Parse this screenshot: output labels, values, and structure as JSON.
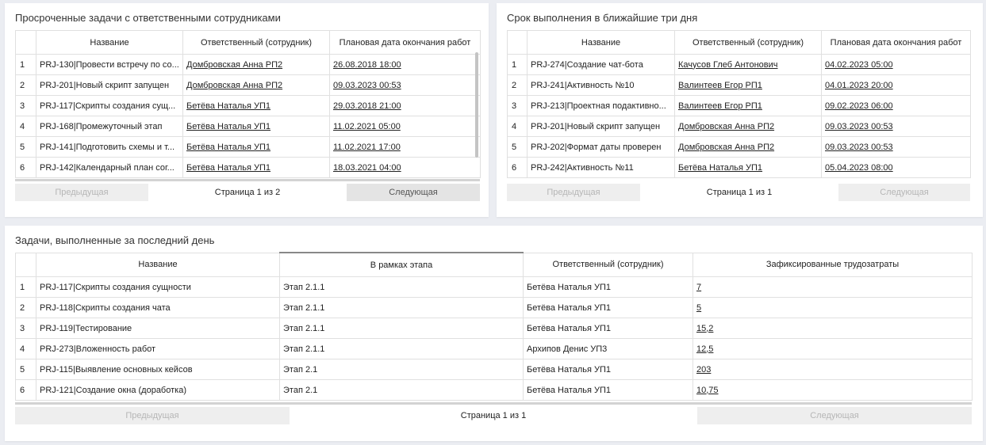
{
  "overdue": {
    "title": "Просроченные задачи с ответственными сотрудниками",
    "columns": [
      "",
      "Название",
      "Ответственный (сотрудник)",
      "Плановая дата окончания работ"
    ],
    "rows": [
      {
        "n": "1",
        "name": "PRJ-130|Провести встречу по со...",
        "person": "Домбровская Анна РП2",
        "date": "26.08.2018 18:00"
      },
      {
        "n": "2",
        "name": "PRJ-201|Новый скрипт запущен",
        "person": "Домбровская Анна РП2",
        "date": "09.03.2023 00:53"
      },
      {
        "n": "3",
        "name": "PRJ-117|Скрипты создания сущ...",
        "person": "Бетёва Наталья УП1",
        "date": "29.03.2018 21:00"
      },
      {
        "n": "4",
        "name": "PRJ-168|Промежуточный этап",
        "person": "Бетёва Наталья УП1",
        "date": "11.02.2021 05:00"
      },
      {
        "n": "5",
        "name": "PRJ-141|Подготовить схемы и т...",
        "person": "Бетёва Наталья УП1",
        "date": "11.02.2021 17:00"
      },
      {
        "n": "6",
        "name": "PRJ-142|Календарный план сог...",
        "person": "Бетёва Наталья УП1",
        "date": "18.03.2021 04:00"
      }
    ],
    "pager": {
      "prev": "Предыдущая",
      "info": "Страница 1 из 2",
      "next": "Следующая"
    }
  },
  "due_soon": {
    "title": "Срок выполнения в ближайшие три дня",
    "columns": [
      "",
      "Название",
      "Ответственный (сотрудник)",
      "Плановая дата окончания работ"
    ],
    "rows": [
      {
        "n": "1",
        "name": "PRJ-274|Создание чат-бота",
        "person": "Качусов Глеб Антонович",
        "date": "04.02.2023 05:00"
      },
      {
        "n": "2",
        "name": "PRJ-241|Активность №10",
        "person": "Валинтеев Егор РП1",
        "date": "04.01.2023 20:00"
      },
      {
        "n": "3",
        "name": "PRJ-213|Проектная подактивно...",
        "person": "Валинтеев Егор РП1",
        "date": "09.02.2023 06:00"
      },
      {
        "n": "4",
        "name": "PRJ-201|Новый скрипт запущен",
        "person": "Домбровская Анна РП2",
        "date": "09.03.2023 00:53"
      },
      {
        "n": "5",
        "name": "PRJ-202|Формат даты проверен",
        "person": "Домбровская Анна РП2",
        "date": "09.03.2023 00:53"
      },
      {
        "n": "6",
        "name": "PRJ-242|Активность №11",
        "person": "Бетёва Наталья УП1",
        "date": "05.04.2023 08:00"
      }
    ],
    "pager": {
      "prev": "Предыдущая",
      "info": "Страница 1 из 1",
      "next": "Следующая"
    }
  },
  "done": {
    "title": "Задачи, выполненные за последний день",
    "columns": [
      "",
      "Название",
      "В рамках этапа",
      "Ответственный (сотрудник)",
      "Зафиксированные трудозатраты"
    ],
    "rows": [
      {
        "n": "1",
        "name": "PRJ-117|Скрипты создания сущности",
        "stage": "Этап 2.1.1",
        "person": "Бетёва Наталья УП1",
        "effort": "7"
      },
      {
        "n": "2",
        "name": "PRJ-118|Скрипты создания чата",
        "stage": "Этап 2.1.1",
        "person": "Бетёва Наталья УП1",
        "effort": "5"
      },
      {
        "n": "3",
        "name": "PRJ-119|Тестирование",
        "stage": "Этап 2.1.1",
        "person": "Бетёва Наталья УП1",
        "effort": "15,2"
      },
      {
        "n": "4",
        "name": "PRJ-273|Вложенность работ",
        "stage": "Этап 2.1.1",
        "person": "Архипов Денис УП3",
        "effort": "12,5"
      },
      {
        "n": "5",
        "name": "PRJ-115|Выявление основных кейсов",
        "stage": "Этап 2.1",
        "person": "Бетёва Наталья УП1",
        "effort": "203"
      },
      {
        "n": "6",
        "name": "PRJ-121|Создание окна (доработка)",
        "stage": "Этап 2.1",
        "person": "Бетёва Наталья УП1",
        "effort": "10,75"
      }
    ],
    "pager": {
      "prev": "Предыдущая",
      "info": "Страница 1 из 1",
      "next": "Следующая"
    }
  }
}
